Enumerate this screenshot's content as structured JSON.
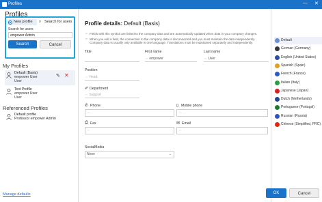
{
  "window": {
    "title": "Profiles",
    "minimize": "—",
    "close": "✕"
  },
  "left": {
    "title": "Profiles",
    "tabs": [
      {
        "label": "New profile"
      },
      {
        "label": "Search for users"
      }
    ],
    "search_label": "Search for users",
    "search_value": "empower Admin",
    "search_button": "Search",
    "cancel_button": "Cancel",
    "my_profiles_title": "My Profiles",
    "my_profiles": [
      {
        "name": "Default (Basis)",
        "line1": "empower User",
        "line2": "User"
      },
      {
        "name": "Text Profile",
        "line1": "empower User",
        "line2": "User"
      }
    ],
    "referenced_title": "Referenced Profiles",
    "referenced": [
      {
        "name": "Default profile",
        "line1": "Professor empower Admin"
      }
    ],
    "manage_link": "Manage defaults"
  },
  "main": {
    "title_bold": "Profile details:",
    "title_rest": " Default (Basis)",
    "note1": "Fields with this symbol are linked to the company data and are automatically updated when data in your company changes.",
    "note2a": "When you edit a field, the connection to the company data is disconnected and you must maintain the data independently.",
    "note2b": "Company data is usually only available in one language. Translations must be maintained separately and independently.",
    "labels": {
      "title": "Title",
      "first_name": "First name",
      "last_name": "Last name",
      "position": "Position",
      "department": "Department",
      "phone": "Phone",
      "mobile": "Mobile phone",
      "fax": "Fax",
      "email": "Email",
      "social": "SocialMedia"
    },
    "values": {
      "first_name": "empower",
      "last_name": "User",
      "social": "None"
    },
    "placeholders": {
      "position": "Head",
      "department": "Support"
    }
  },
  "languages": [
    {
      "name": "Default",
      "color": "#6a8fd0"
    },
    {
      "name": "German (Germany)",
      "color": "#333333"
    },
    {
      "name": "English (United States)",
      "color": "#2d4f9e"
    },
    {
      "name": "Spanish (Spain)",
      "color": "#e0a020"
    },
    {
      "name": "French (France)",
      "color": "#2b5cc4"
    },
    {
      "name": "Italian (Italy)",
      "color": "#2e9e44"
    },
    {
      "name": "Japanese (Japan)",
      "color": "#d02020"
    },
    {
      "name": "Dutch (Netherlands)",
      "color": "#21468b"
    },
    {
      "name": "Portuguese (Portugal)",
      "color": "#1e7a30"
    },
    {
      "name": "Russian (Russia)",
      "color": "#3355bb"
    },
    {
      "name": "Chinese (Simplified, PRC)",
      "color": "#de2910"
    }
  ],
  "footer": {
    "ok": "OK",
    "cancel": "Cancel"
  },
  "colors": {
    "accent": "#1a73c8",
    "highlight": "#1ea6d6",
    "danger": "#d9231f"
  }
}
